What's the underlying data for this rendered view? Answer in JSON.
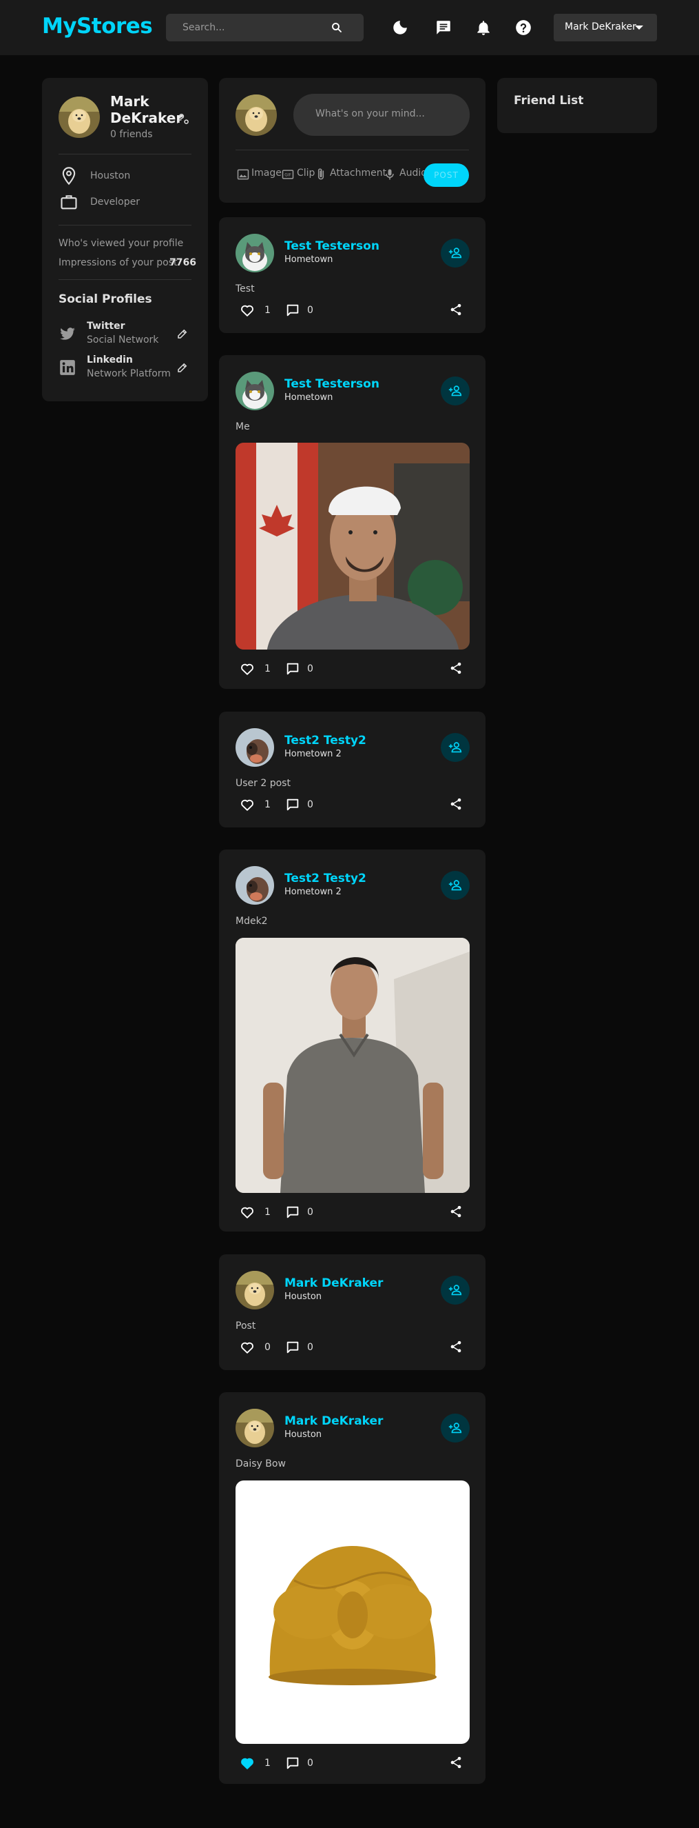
{
  "navbar": {
    "logo": "MyStores",
    "search_placeholder": "Search...",
    "user_name": "Mark DeKraker"
  },
  "profile": {
    "name": "Mark DeKraker",
    "friends": "0 friends",
    "location": "Houston",
    "occupation": "Developer",
    "viewed_label": "Who's viewed your profile",
    "viewed_value": "",
    "impressions_label": "Impressions of your post",
    "impressions_value": "7766",
    "social_title": "Social Profiles",
    "socials": [
      {
        "name": "Twitter",
        "type": "Social Network"
      },
      {
        "name": "Linkedin",
        "type": "Network Platform"
      }
    ]
  },
  "composer": {
    "placeholder": "What's on your mind...",
    "tools": [
      "Image",
      "Clip",
      "Attachment",
      "Audio"
    ],
    "post_label": "POST"
  },
  "posts": [
    {
      "author": "Test Testerson",
      "location": "Hometown",
      "description": "Test",
      "likes": "1",
      "comments": "0",
      "liked": false,
      "image": null
    },
    {
      "author": "Test Testerson",
      "location": "Hometown",
      "description": "Me",
      "likes": "1",
      "comments": "0",
      "liked": false,
      "image": "selfie photo"
    },
    {
      "author": "Test2 Testy2",
      "location": "Hometown 2",
      "description": "User 2 post",
      "likes": "1",
      "comments": "0",
      "liked": false,
      "image": null
    },
    {
      "author": "Test2 Testy2",
      "location": "Hometown 2",
      "description": "Mdek2",
      "likes": "1",
      "comments": "0",
      "liked": false,
      "image": "portrait photo"
    },
    {
      "author": "Mark DeKraker",
      "location": "Houston",
      "description": "Post",
      "likes": "0",
      "comments": "0",
      "liked": false,
      "image": null
    },
    {
      "author": "Mark DeKraker",
      "location": "Houston",
      "description": "Daisy Bow",
      "likes": "1",
      "comments": "0",
      "liked": true,
      "image": "turban photo"
    }
  ],
  "friend_list": {
    "title": "Friend List"
  },
  "colors": {
    "accent": "#00d5fa",
    "background": "#0a0a0a",
    "card": "#1a1a1a",
    "input": "#333333"
  }
}
